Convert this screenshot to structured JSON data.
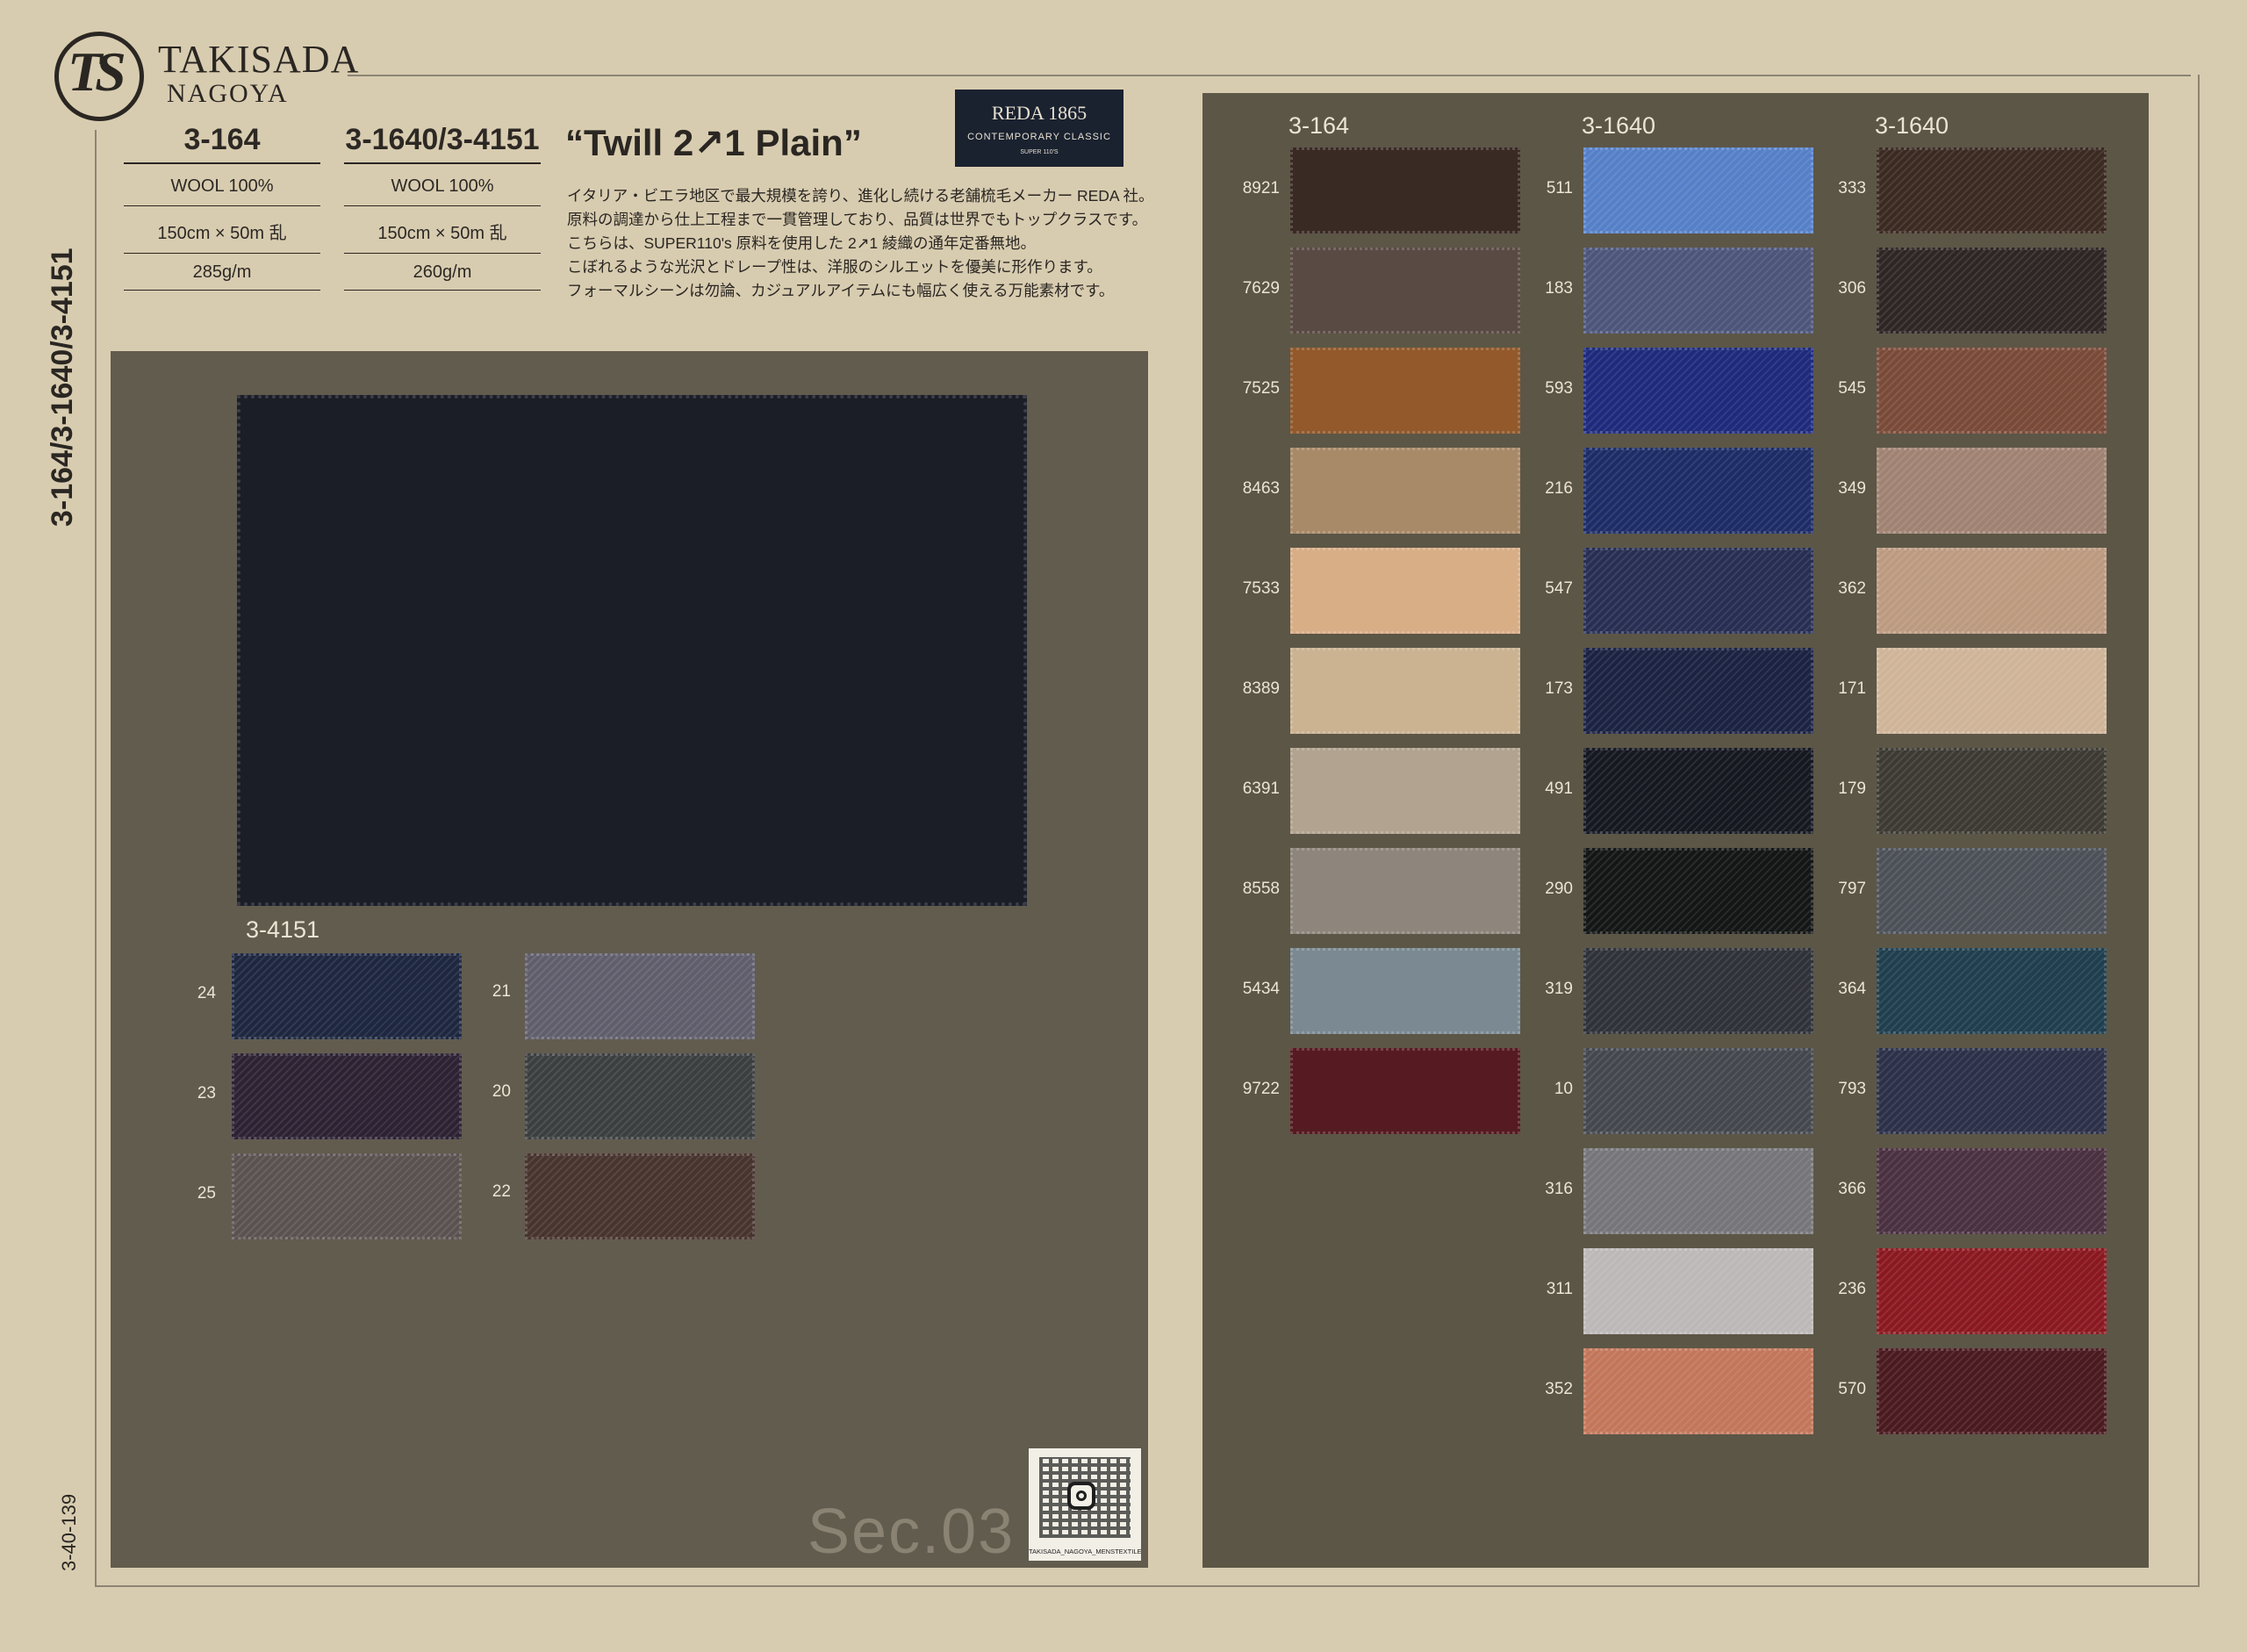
{
  "brand": {
    "logo_letters": "TS",
    "name": "TAKISADA",
    "location": "NAGOYA"
  },
  "side_title": "3-164/3-1640/3-4151",
  "page_code": "3-40-139",
  "specs": [
    {
      "code": "3-164",
      "composition": "WOOL 100%",
      "size": "150cm × 50m 乱",
      "weight": "285g/m"
    },
    {
      "code": "3-1640/3-4151",
      "composition": "WOOL 100%",
      "size": "150cm × 50m 乱",
      "weight": "260g/m"
    }
  ],
  "title": "“Twill 2↗1 Plain”",
  "reda_badge": {
    "line1": "REDA 1865",
    "line2": "CONTEMPORARY CLASSIC",
    "line3": "SUPER 110'S"
  },
  "description": "イタリア・ビエラ地区で最大規模を誇り、進化し続ける老舗梳毛メーカー REDA 社。\n原料の調達から仕上工程まで一貫管理しており、品質は世界でもトップクラスです。\nこちらは、SUPER110's 原料を使用した 2↗1 綾織の通年定番無地。\nこぼれるような光沢とドレープ性は、洋服のシルエットを優美に形作ります。\nフォーマルシーンは勿論、カジュアルアイテムにも幅広く使える万能素材です。",
  "left_group": {
    "label": "3-4151",
    "col1": [
      {
        "num": "24",
        "color": "#1e2740"
      },
      {
        "num": "23",
        "color": "#2c2233"
      },
      {
        "num": "25",
        "color": "#5a5250"
      }
    ],
    "col2": [
      {
        "num": "21",
        "color": "#605e6c"
      },
      {
        "num": "20",
        "color": "#3c3f40"
      },
      {
        "num": "22",
        "color": "#48342e"
      }
    ]
  },
  "right_groups": [
    {
      "label": "3-164",
      "items": [
        {
          "num": "8921",
          "color": "#3a2a24"
        },
        {
          "num": "7629",
          "color": "#5a4a44"
        },
        {
          "num": "7525",
          "color": "#93592a"
        },
        {
          "num": "8463",
          "color": "#a98a68"
        },
        {
          "num": "7533",
          "color": "#d8ae86"
        },
        {
          "num": "8389",
          "color": "#cbb392"
        },
        {
          "num": "6391",
          "color": "#b1a38f"
        },
        {
          "num": "8558",
          "color": "#8e857c"
        },
        {
          "num": "5434",
          "color": "#7b8a92"
        },
        {
          "num": "9722",
          "color": "#561b22"
        }
      ]
    },
    {
      "label": "3-1640",
      "items": [
        {
          "num": "511",
          "color": "#5580c8"
        },
        {
          "num": "183",
          "color": "#4d557a"
        },
        {
          "num": "593",
          "color": "#1e2a7c"
        },
        {
          "num": "216",
          "color": "#1d2c66"
        },
        {
          "num": "547",
          "color": "#272e52"
        },
        {
          "num": "173",
          "color": "#1b2242"
        },
        {
          "num": "491",
          "color": "#161821"
        },
        {
          "num": "290",
          "color": "#141616"
        },
        {
          "num": "319",
          "color": "#2f3238"
        },
        {
          "num": "10",
          "color": "#44484e"
        },
        {
          "num": "316",
          "color": "#76767a"
        },
        {
          "num": "311",
          "color": "#bcb8b8"
        },
        {
          "num": "352",
          "color": "#c2765a"
        }
      ]
    },
    {
      "label": "3-1640",
      "items": [
        {
          "num": "333",
          "color": "#3a2a22"
        },
        {
          "num": "306",
          "color": "#2e2624"
        },
        {
          "num": "545",
          "color": "#7a4a38"
        },
        {
          "num": "349",
          "color": "#a08272"
        },
        {
          "num": "362",
          "color": "#bc9a80"
        },
        {
          "num": "171",
          "color": "#cfb498"
        },
        {
          "num": "179",
          "color": "#3c3a32"
        },
        {
          "num": "797",
          "color": "#4c5058"
        },
        {
          "num": "364",
          "color": "#1f3e4e"
        },
        {
          "num": "793",
          "color": "#2c3048"
        },
        {
          "num": "366",
          "color": "#4a3040"
        },
        {
          "num": "236",
          "color": "#8a1820"
        },
        {
          "num": "570",
          "color": "#4a1a20"
        }
      ]
    }
  ],
  "section_label": "Sec.03",
  "qr_caption": "TAKISADA_NAGOYA_MENSTEXTILE"
}
